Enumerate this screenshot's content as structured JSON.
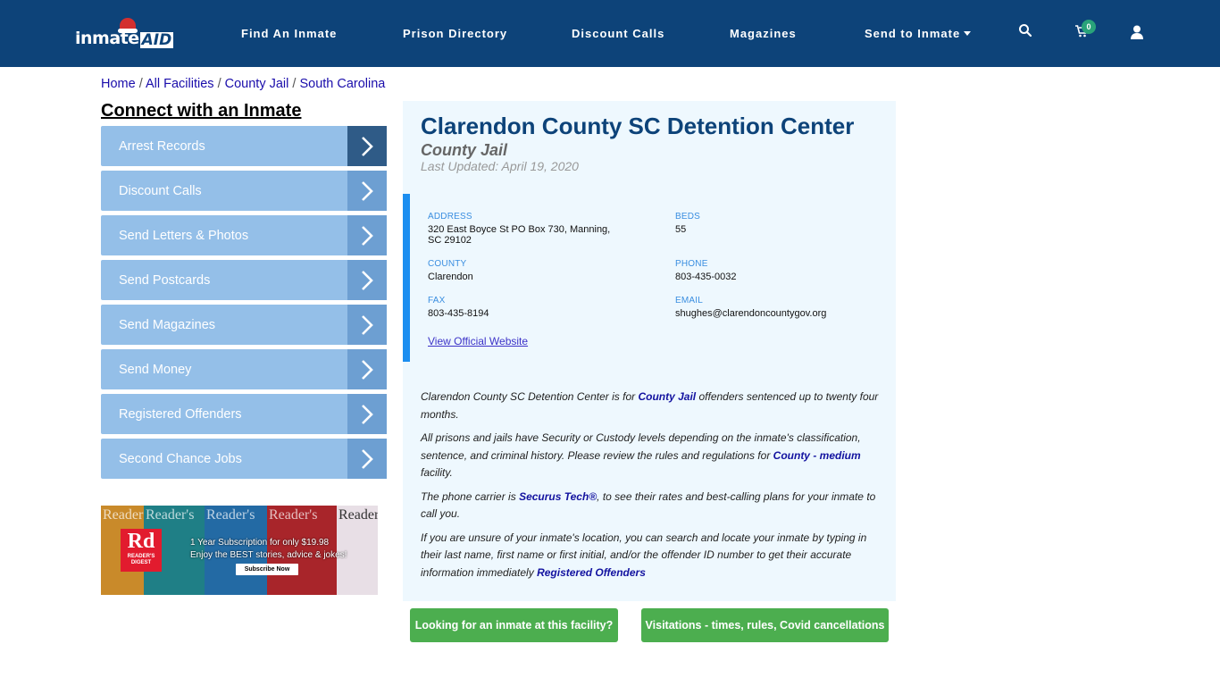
{
  "nav": {
    "logo_text": "inmate",
    "logo_accent": "AID",
    "links": [
      {
        "label": "Find An Inmate"
      },
      {
        "label": "Prison Directory"
      },
      {
        "label": "Discount Calls"
      },
      {
        "label": "Magazines"
      },
      {
        "label": "Send to Inmate"
      }
    ],
    "cart_count": "0",
    "icons": {
      "search": "search-icon",
      "cart": "cart-icon",
      "user": "user-icon"
    }
  },
  "breadcrumb": [
    "Home",
    "All Facilities",
    "County Jail",
    "South Carolina"
  ],
  "breadcrumb_sep": "/",
  "sidebar": {
    "heading": "Connect with an Inmate",
    "items": [
      {
        "label": "Arrest Records"
      },
      {
        "label": "Discount Calls"
      },
      {
        "label": "Send Letters & Photos"
      },
      {
        "label": "Send Postcards"
      },
      {
        "label": "Send Magazines"
      },
      {
        "label": "Send Money"
      },
      {
        "label": "Registered Offenders"
      },
      {
        "label": "Second Chance Jobs"
      }
    ]
  },
  "ad": {
    "brand_short": "Rd",
    "brand_name": "READER'S DIGEST",
    "masthead": "Reader's",
    "line1": "1 Year Subscription for only $19.98",
    "line2": "Enjoy the BEST stories, advice & jokes!",
    "cta": "Subscribe Now"
  },
  "facility": {
    "name": "Clarendon County SC Detention Center",
    "type": "County Jail",
    "last_updated": "Last Updated: April 19, 2020",
    "fields": {
      "address_label": "ADDRESS",
      "address": "320 East Boyce St PO Box 730, Manning, SC 29102",
      "beds_label": "BEDS",
      "beds": "55",
      "county_label": "COUNTY",
      "county": "Clarendon",
      "phone_label": "PHONE",
      "phone": "803-435-0032",
      "fax_label": "FAX",
      "fax": "803-435-8194",
      "email_label": "EMAIL",
      "email": "shughes@clarendoncountygov.org"
    },
    "website_link": "View Official Website"
  },
  "description": {
    "p1_a": "Clarendon County SC Detention Center is for ",
    "p1_link": "County Jail",
    "p1_b": " offenders sentenced up to twenty four months.",
    "p2_a": "All prisons and jails have Security or Custody levels depending on the inmate's classification, sentence, and criminal history. Please review the rules and regulations for ",
    "p2_link": "County - medium",
    "p2_b": " facility.",
    "p3_a": "The phone carrier is ",
    "p3_link": "Securus Tech®",
    "p3_b": ", to see their rates and best-calling plans for your inmate to call you.",
    "p4_a": "If you are unsure of your inmate's location, you can search and locate your inmate by typing in their last name, first name or first initial, and/or the offender ID number to get their accurate information immediately ",
    "p4_link": "Registered Offenders"
  },
  "actions": {
    "find_inmate": "Looking for an inmate at this facility?",
    "visitation": "Visitations - times, rules, Covid cancellations"
  },
  "colors": {
    "nav_bg": "#0d4379",
    "accent_blue": "#1c8ef0",
    "button_green": "#4cae4f",
    "menu_bg": "#94bfe8"
  }
}
